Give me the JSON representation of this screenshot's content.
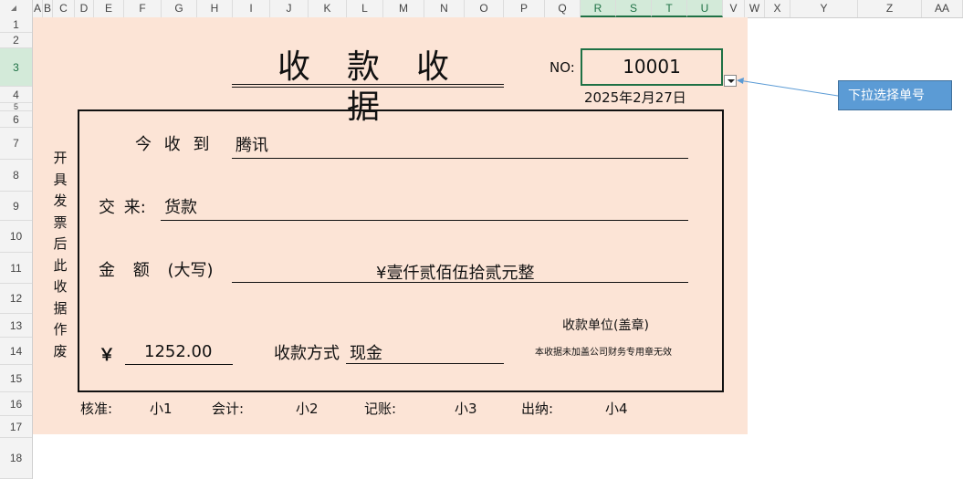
{
  "sheet": {
    "columns": [
      "A",
      "B",
      "C",
      "D",
      "E",
      "F",
      "G",
      "H",
      "I",
      "J",
      "K",
      "L",
      "M",
      "N",
      "O",
      "P",
      "Q",
      "R",
      "S",
      "T",
      "U",
      "V",
      "W",
      "X",
      "Y",
      "Z",
      "AA"
    ],
    "rows": [
      "1",
      "2",
      "3",
      "4",
      "5",
      "6",
      "7",
      "8",
      "9",
      "10",
      "11",
      "12",
      "13",
      "14",
      "15",
      "16",
      "17",
      "18"
    ]
  },
  "receipt": {
    "title": "收款收据",
    "no_label": "NO:",
    "no_value": "10001",
    "date": "2025年2月27日",
    "vertical_note": [
      "开",
      "具",
      "发",
      "票",
      "后",
      "此",
      "收",
      "据",
      "作",
      "废"
    ],
    "received_from_label": "今 收 到",
    "received_from_value": "腾讯",
    "purpose_label": "交 来:",
    "purpose_value": "货款",
    "amount_label": "金 额 (大写)",
    "amount_words": "¥壹仟贰佰伍拾贰元整",
    "currency_symbol": "￥",
    "amount_number": "1252.00",
    "payment_method_label": "收款方式",
    "payment_method_value": "现金",
    "seal_title": "收款单位(盖章)",
    "seal_note": "本收据未加盖公司财务专用章无效"
  },
  "signatures": [
    {
      "label": "核准:",
      "name": "小1"
    },
    {
      "label": "会计:",
      "name": "小2"
    },
    {
      "label": "记账:",
      "name": "小3"
    },
    {
      "label": "出纳:",
      "name": "小4"
    }
  ],
  "callout": {
    "text": "下拉选择单号"
  },
  "colors": {
    "receipt_bg": "#fce4d6",
    "selection": "#1e7145",
    "callout_bg": "#5b9bd5"
  }
}
